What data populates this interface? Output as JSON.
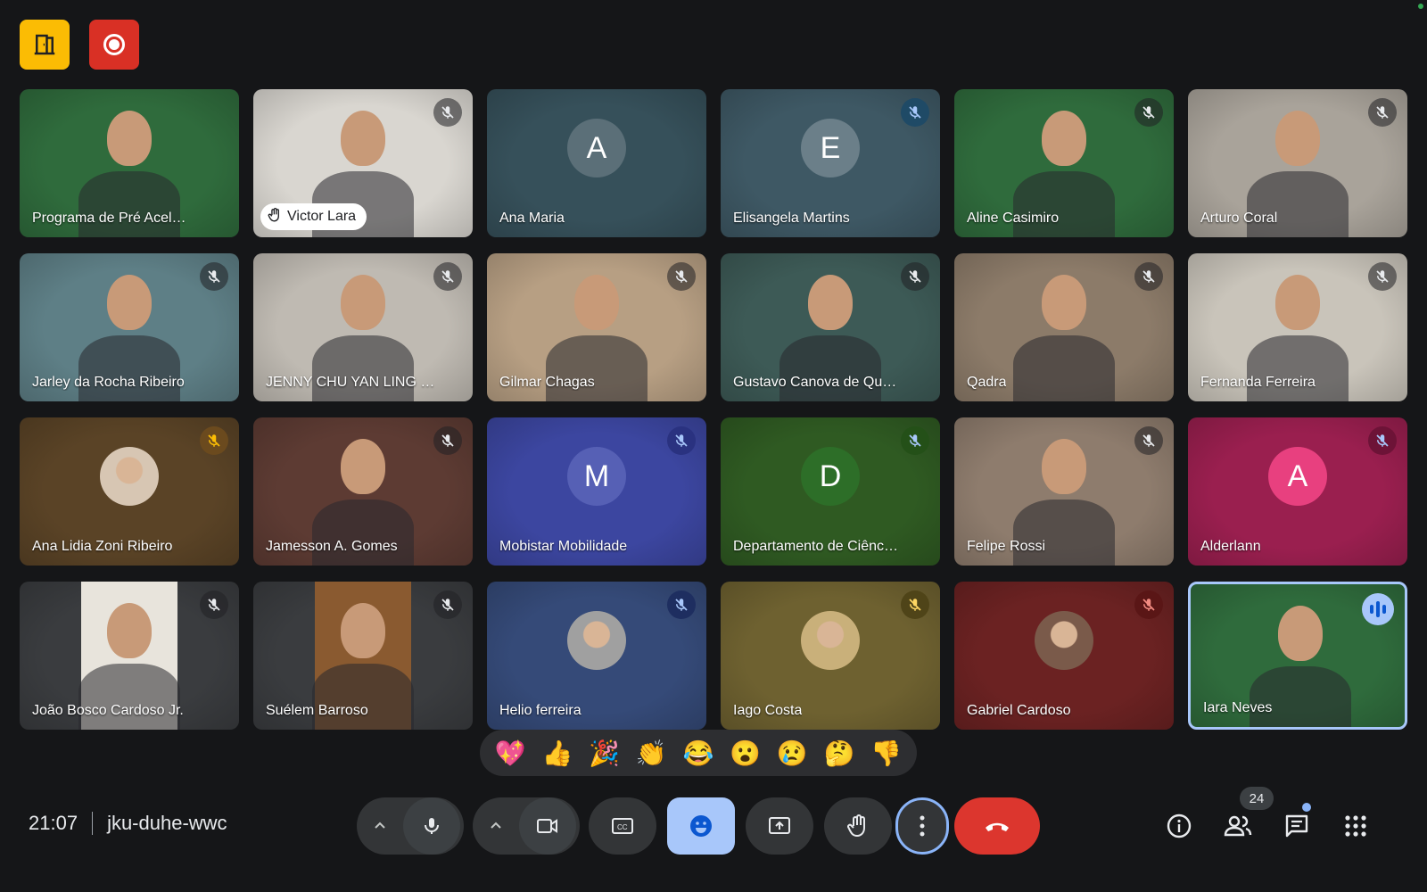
{
  "meeting": {
    "time": "21:07",
    "code": "jku-duhe-wwc",
    "participant_count": "24"
  },
  "participants": [
    {
      "name": "Programa de Pré Acel…",
      "kind": "video",
      "bg": "#2f6b3c",
      "muted": false,
      "hand_raised": false,
      "speaking": false
    },
    {
      "name": "Victor Lara",
      "kind": "video",
      "bg": "#d9d6d0",
      "muted": true,
      "hand_raised": true,
      "speaking": false
    },
    {
      "name": "Ana Maria",
      "kind": "letter",
      "letter": "A",
      "bg": "#36505a",
      "avatar_bg": "#5b6f78",
      "muted": false,
      "hand_raised": false,
      "speaking": false
    },
    {
      "name": "Elisangela Martins",
      "kind": "letter",
      "letter": "E",
      "bg": "#3e5864",
      "avatar_bg": "#6b7f89",
      "muted": true,
      "mute_bg": "#1f4a66",
      "hand_raised": false,
      "speaking": false
    },
    {
      "name": "Aline Casimiro",
      "kind": "video",
      "bg": "#2f6b3c",
      "muted": true,
      "hand_raised": false,
      "speaking": false
    },
    {
      "name": "Arturo Coral",
      "kind": "video",
      "bg": "#a9a39a",
      "muted": true,
      "hand_raised": false,
      "speaking": false
    },
    {
      "name": "Jarley da Rocha Ribeiro",
      "kind": "video",
      "bg": "#5e7f86",
      "muted": true,
      "hand_raised": false,
      "speaking": false
    },
    {
      "name": "JENNY CHU YAN LING …",
      "kind": "video",
      "bg": "#bfbab2",
      "muted": true,
      "hand_raised": false,
      "speaking": false
    },
    {
      "name": "Gilmar Chagas",
      "kind": "video",
      "bg": "#b79f83",
      "muted": true,
      "hand_raised": false,
      "speaking": false
    },
    {
      "name": "Gustavo Canova de Qu…",
      "kind": "video",
      "bg": "#3d5a56",
      "muted": true,
      "hand_raised": false,
      "speaking": false
    },
    {
      "name": "Qadra",
      "kind": "video",
      "bg": "#8c7b69",
      "muted": true,
      "hand_raised": false,
      "speaking": false
    },
    {
      "name": "Fernanda Ferreira",
      "kind": "video",
      "bg": "#c9c4ba",
      "muted": true,
      "hand_raised": false,
      "speaking": false
    },
    {
      "name": "Ana Lidia Zoni Ribeiro",
      "kind": "photo",
      "bg": "#5a4326",
      "avatar_bg": "#d7c6b3",
      "muted": true,
      "mute_bg": "#6b4a1e",
      "mute_color": "#fbbc04",
      "hand_raised": false,
      "speaking": false
    },
    {
      "name": "Jamesson A. Gomes",
      "kind": "video",
      "bg": "#5d3b33",
      "muted": true,
      "hand_raised": false,
      "speaking": false
    },
    {
      "name": "Mobistar Mobilidade",
      "kind": "letter",
      "letter": "M",
      "bg": "#3c46a0",
      "avatar_bg": "#5660b5",
      "muted": true,
      "mute_bg": "#2a3280",
      "hand_raised": false,
      "speaking": false
    },
    {
      "name": "Departamento de Ciênc…",
      "kind": "letter",
      "letter": "D",
      "bg": "#2f5a22",
      "avatar_bg": "#2d6e28",
      "muted": true,
      "mute_bg": "#245018",
      "hand_raised": false,
      "speaking": false
    },
    {
      "name": "Felipe Rossi",
      "kind": "video",
      "bg": "#8e7c6d",
      "muted": true,
      "hand_raised": false,
      "speaking": false
    },
    {
      "name": "Alderlann",
      "kind": "letter",
      "letter": "A",
      "bg": "#9a1f4f",
      "avatar_bg": "#e8407f",
      "muted": true,
      "mute_bg": "#6d1337",
      "hand_raised": false,
      "speaking": false
    },
    {
      "name": "João Bosco Cardoso Jr.",
      "kind": "video",
      "bg": "#3a3c3f",
      "inner_bg": "#e8e4dc",
      "muted": true,
      "hand_raised": false,
      "speaking": false
    },
    {
      "name": "Suélem Barroso",
      "kind": "video",
      "bg": "#3a3c3f",
      "inner_bg": "#8a5a30",
      "muted": true,
      "hand_raised": false,
      "speaking": false
    },
    {
      "name": "Helio ferreira",
      "kind": "photo",
      "bg": "#354a78",
      "avatar_bg": "#a0a0a0",
      "muted": true,
      "mute_bg": "#1e2e60",
      "hand_raised": false,
      "speaking": false
    },
    {
      "name": "Iago Costa",
      "kind": "photo",
      "bg": "#6e6130",
      "avatar_bg": "#c9b07a",
      "muted": true,
      "mute_bg": "#4f4418",
      "mute_color": "#fdd663",
      "hand_raised": false,
      "speaking": false
    },
    {
      "name": "Gabriel Cardoso",
      "kind": "photo",
      "bg": "#6b2222",
      "avatar_bg": "#7a5a4a",
      "muted": true,
      "mute_bg": "#5a1616",
      "mute_color": "#f28b82",
      "hand_raised": false,
      "speaking": false
    },
    {
      "name": "Iara Neves",
      "kind": "video",
      "bg": "#2f6b3c",
      "muted": false,
      "hand_raised": false,
      "speaking": true,
      "self": true
    }
  ],
  "reactions": [
    "💖",
    "👍",
    "🎉",
    "👏",
    "😂",
    "😮",
    "😢",
    "🤔",
    "👎"
  ],
  "controls": {
    "mic_icon": "microphone-icon",
    "camera_icon": "camera-icon",
    "captions_icon": "closed-captions-icon",
    "emoji_icon": "emoji-icon",
    "present_icon": "present-screen-icon",
    "hand_icon": "raise-hand-icon",
    "more_icon": "more-options-icon",
    "end_icon": "end-call-icon"
  },
  "colors": {
    "accent": "#a8c7fa",
    "end_call": "#dc362e",
    "door_button": "#fbbc04",
    "record_button": "#d93025"
  }
}
